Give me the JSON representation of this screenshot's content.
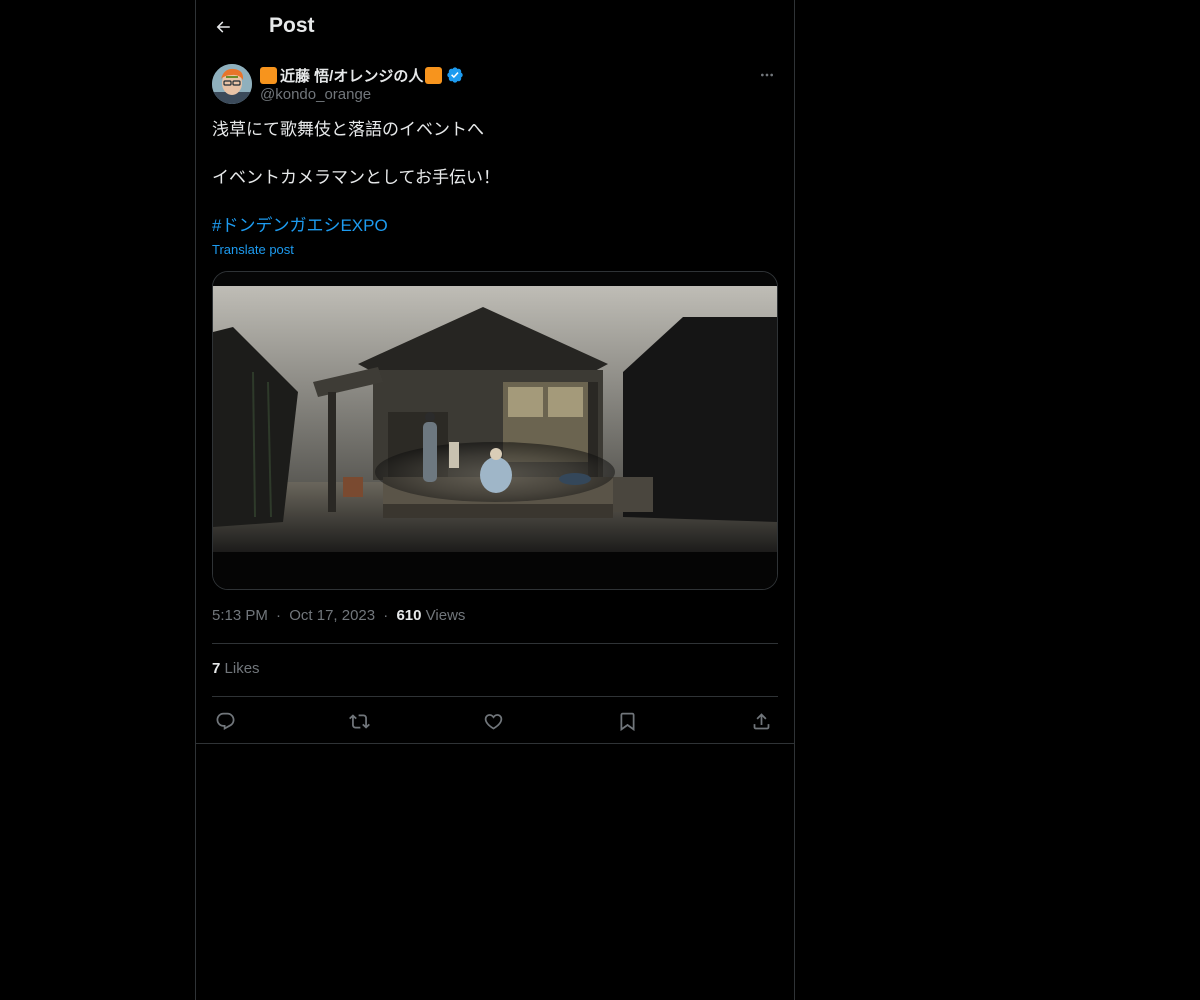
{
  "header": {
    "title": "Post",
    "back_icon": "arrow-left-icon"
  },
  "author": {
    "display_name": "近藤 悟/オレンジの人",
    "handle": "@kondo_orange",
    "verified": true,
    "badge_color": "#1d9bf0",
    "emoji_color": "#f7941d"
  },
  "post": {
    "lines": [
      "浅草にて歌舞伎と落語のイベントへ",
      "イベントカメラマンとしてお手伝い！"
    ],
    "hashtag": "#ドンデンガエシEXPO",
    "translate_label": "Translate post",
    "media_description_icon": "stage-photo-image"
  },
  "meta": {
    "time": "5:13 PM",
    "date": "Oct 17, 2023",
    "separator": "·",
    "views_count": "610",
    "views_label": "Views"
  },
  "stats": {
    "likes_count": "7",
    "likes_label": "Likes"
  },
  "actions": [
    {
      "name": "reply",
      "icon": "reply-icon"
    },
    {
      "name": "repost",
      "icon": "repost-icon"
    },
    {
      "name": "like",
      "icon": "heart-icon"
    },
    {
      "name": "bookmark",
      "icon": "bookmark-icon"
    },
    {
      "name": "share",
      "icon": "share-icon"
    }
  ],
  "colors": {
    "background": "#000000",
    "border": "#2f3336",
    "text_primary": "#e7e9ea",
    "text_secondary": "#71767b",
    "accent": "#1d9bf0"
  }
}
